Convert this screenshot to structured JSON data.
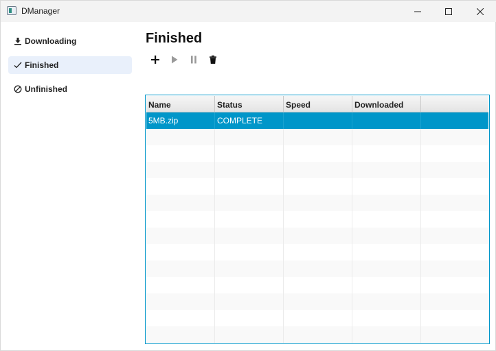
{
  "window": {
    "title": "DManager"
  },
  "sidebar": {
    "items": [
      {
        "label": "Downloading",
        "icon": "download-icon",
        "active": false
      },
      {
        "label": "Finished",
        "icon": "checkmark-icon",
        "active": true
      },
      {
        "label": "Unfinished",
        "icon": "circle-slash-icon",
        "active": false
      }
    ]
  },
  "main": {
    "title": "Finished",
    "toolbar": [
      {
        "icon": "add-icon",
        "enabled": true
      },
      {
        "icon": "play-icon",
        "enabled": false
      },
      {
        "icon": "pause-icon",
        "enabled": false
      },
      {
        "icon": "trash-icon",
        "enabled": true
      }
    ]
  },
  "table": {
    "columns": [
      "Name",
      "Status",
      "Speed",
      "Downloaded",
      ""
    ],
    "rows": [
      {
        "name": "5MB.zip",
        "status": "COMPLETE",
        "speed": "",
        "downloaded": "",
        "selected": true
      }
    ]
  },
  "colors": {
    "accent": "#0096c9",
    "active_item": "#e9f0fb",
    "titlebar": "#f3f3f3"
  }
}
